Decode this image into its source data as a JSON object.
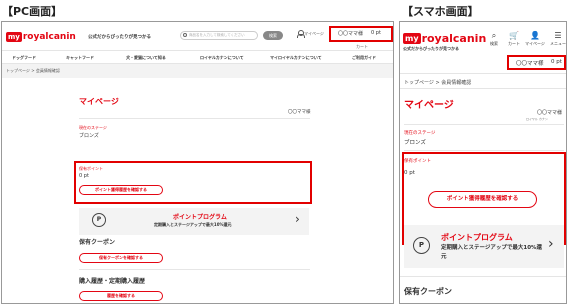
{
  "labels": {
    "pc": "【PC画面】",
    "sp": "【スマホ画面】"
  },
  "brand": {
    "badge": "my",
    "name": "royalcanin",
    "tagline": "公式だからぴったりが見つかる"
  },
  "pc": {
    "search_placeholder": "商品名を入力して検索してください",
    "search_button": "検索",
    "mypage_link": "マイページ",
    "cart_link": "カート",
    "user_name": "〇〇ママ様",
    "user_points": "0 pt",
    "nav": [
      "ドッグフード",
      "キャットフード",
      "犬・愛猫について知る",
      "ロイヤルカナンについて",
      "マイロイヤルカナンについて",
      "ご利用ガイド"
    ],
    "breadcrumb": "トップページ > 会員情報確認"
  },
  "sp": {
    "icons": [
      {
        "name": "search-icon",
        "glyph": "⌕",
        "label": "検索"
      },
      {
        "name": "cart-icon",
        "glyph": "🛒",
        "label": "カート"
      },
      {
        "name": "mypage-icon",
        "glyph": "👤",
        "label": "マイページ"
      },
      {
        "name": "menu-icon",
        "glyph": "☰",
        "label": "メニュー"
      }
    ],
    "user_name": "〇〇ママ様",
    "user_points": "0 pt",
    "breadcrumb": "トップページ > 会員情報確認",
    "sama_sub": "ロイヤル カナン"
  },
  "main": {
    "title": "マイページ",
    "user_greeting": "〇〇ママ様",
    "stage_label": "現在のステージ",
    "stage_value": "ブロンズ",
    "points_label": "保有ポイント",
    "points_value": "0 pt",
    "points_history_button": "ポイント獲得履歴を確認する",
    "program_title": "ポイントプログラム",
    "program_desc": "定期購入とステージアップで最大10%還元",
    "coupon_title": "保有クーポン",
    "coupon_button": "保有クーポンを確認する",
    "purchase_title": "購入履歴・定期購入履歴",
    "purchase_button": "履歴を確認する"
  },
  "colors": {
    "accent": "#e30613",
    "highlight_box": "#e20000",
    "panel": "#f3f3f3"
  }
}
